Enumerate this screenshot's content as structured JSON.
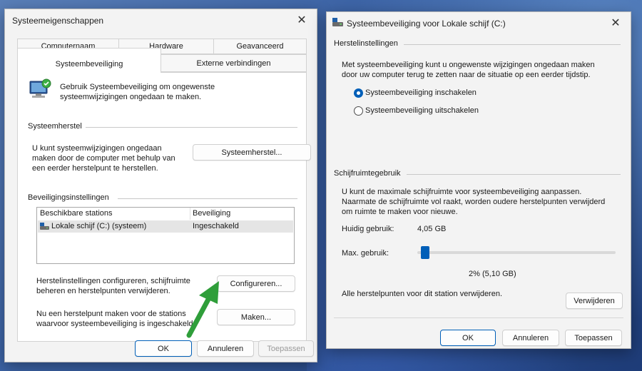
{
  "left_dialog": {
    "title": "Systeemeigenschappen",
    "tabs": {
      "computername": "Computernaam",
      "hardware": "Hardware",
      "advanced": "Geavanceerd",
      "system_protection": "Systeembeveiliging",
      "remote": "Externe verbindingen"
    },
    "intro_line1": "Gebruik Systeembeveiliging om ongewenste",
    "intro_line2": "systeemwijzigingen ongedaan te maken.",
    "restore_group": "Systeemherstel",
    "restore_text_line1": "U kunt systeemwijzigingen ongedaan",
    "restore_text_line2": "maken door de computer met behulp van",
    "restore_text_line3": "een eerder herstelpunt te herstellen.",
    "restore_button": "Systeemherstel...",
    "protection_group": "Beveiligingsinstellingen",
    "list_headers": {
      "drives": "Beschikbare stations",
      "protection": "Beveiliging"
    },
    "list_rows": [
      {
        "drive": "Lokale schijf (C:) (systeem)",
        "protection": "Ingeschakeld"
      }
    ],
    "configure_text_line1": "Herstelinstellingen configureren, schijfruimte",
    "configure_text_line2": "beheren en herstelpunten verwijderen.",
    "configure_button": "Configureren...",
    "create_text_line1": "Nu een herstelpunt maken voor de stations",
    "create_text_line2": "waarvoor systeembeveiliging is ingeschakeld.",
    "create_button": "Maken...",
    "ok": "OK",
    "cancel": "Annuleren",
    "apply": "Toepassen"
  },
  "right_dialog": {
    "title": "Systeembeveiliging voor Lokale schijf (C:)",
    "restore_settings_group": "Herstelinstellingen",
    "restore_text_line1": "Met systeembeveiliging kunt u ongewenste wijzigingen ongedaan maken",
    "restore_text_line2": "door uw computer terug te zetten naar de situatie op een eerder tijdstip.",
    "radio_on": "Systeembeveiliging inschakelen",
    "radio_off": "Systeembeveiliging uitschakelen",
    "radio_selected": "on",
    "disk_group": "Schijfruimtegebruik",
    "disk_text_line1": "U kunt de maximale schijfruimte voor systeembeveiliging aanpassen.",
    "disk_text_line2": "Naarmate de schijfruimte vol raakt, worden oudere herstelpunten verwijderd",
    "disk_text_line3": "om ruimte te maken voor nieuwe.",
    "current_usage_label": "Huidig gebruik:",
    "current_usage_value": "4,05 GB",
    "max_usage_label": "Max. gebruik:",
    "max_usage_percent": 2,
    "max_usage_display": "2% (5,10 GB)",
    "delete_text": "Alle herstelpunten voor dit station verwijderen.",
    "delete_button": "Verwijderen",
    "ok": "OK",
    "cancel": "Annuleren",
    "apply": "Toepassen"
  },
  "colors": {
    "accent": "#005fb8",
    "arrow": "#2f9e3a"
  }
}
